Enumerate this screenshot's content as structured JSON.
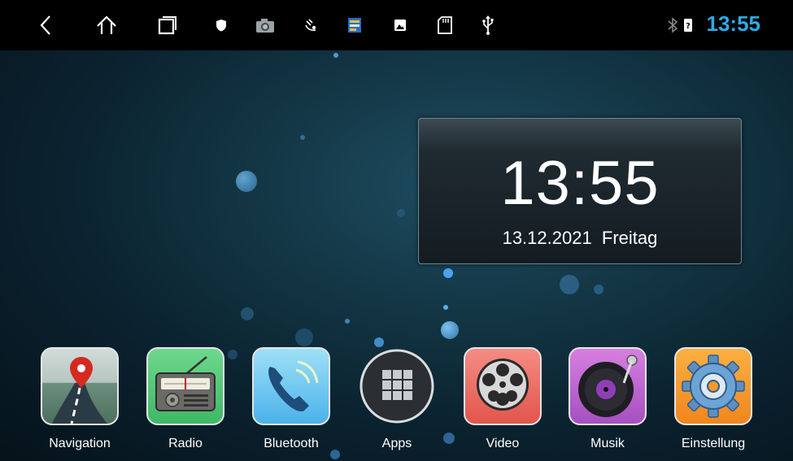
{
  "statusbar": {
    "time": "13:55",
    "icons": [
      "back-icon",
      "home-icon",
      "recents-icon",
      "shield-icon",
      "camera-icon",
      "satellite-icon",
      "gallery-app-icon",
      "image-icon",
      "sd-card-icon",
      "usb-icon",
      "bluetooth-icon",
      "phone-status-icon"
    ]
  },
  "clock": {
    "time": "13:55",
    "date": "13.12.2021",
    "weekday": "Freitag"
  },
  "apps": [
    {
      "label": "Navigation"
    },
    {
      "label": "Radio"
    },
    {
      "label": "Bluetooth"
    },
    {
      "label": "Apps"
    },
    {
      "label": "Video"
    },
    {
      "label": "Musik"
    },
    {
      "label": "Einstellung"
    }
  ],
  "colors": {
    "accent": "#2fa9e6",
    "background": "#143847"
  }
}
